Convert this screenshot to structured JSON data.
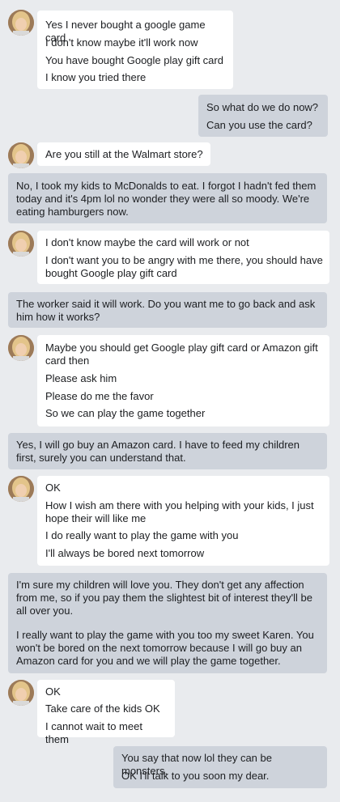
{
  "messages": [
    {
      "from": "them",
      "lines": [
        "Yes I never bought a google game card",
        "I don't know maybe it'll work now",
        "You have bought Google play gift card",
        "I know you tried there"
      ]
    },
    {
      "from": "me",
      "lines": [
        "So what do we do now?",
        "Can you use the card?"
      ]
    },
    {
      "from": "them",
      "lines": [
        "Are you still at the Walmart store?"
      ]
    },
    {
      "from": "me",
      "lines": [
        "No, I took my kids to McDonalds to eat. I forgot I hadn't fed them today and it's  4pm lol no wonder they were all so moody. We're eating hamburgers now."
      ]
    },
    {
      "from": "them",
      "lines": [
        "I don't know maybe the card will work or not",
        "I don't want you to be angry with me there, you should have bought Google play gift card"
      ]
    },
    {
      "from": "me",
      "lines": [
        "The worker said it will work. Do you want me to go back and ask him how it works?"
      ]
    },
    {
      "from": "them",
      "lines": [
        "Maybe you should get Google play gift card or Amazon gift card then",
        "Please ask him",
        "Please do me the favor",
        "So we can play the game together"
      ]
    },
    {
      "from": "me",
      "lines": [
        "Yes, I will go buy an Amazon card. I have to feed my children first, surely you can understand that."
      ]
    },
    {
      "from": "them",
      "lines": [
        "OK",
        "How I wish am there with you helping with your kids, I just hope their will like me",
        "I do really want to play the game with you",
        "I'll always be bored next tomorrow"
      ]
    },
    {
      "from": "me",
      "lines": [
        "I'm sure my children will love you. They don't get any affection from me, so if you pay them the slightest bit of interest they'll be all over you.",
        "I really want to play the game with you too my sweet Karen. You won't be bored on the next tomorrow because I will go buy an Amazon card for you and we will play the game together."
      ]
    },
    {
      "from": "them",
      "lines": [
        "OK",
        "Take care of the kids OK",
        "I cannot wait to meet them"
      ]
    },
    {
      "from": "me",
      "lines": [
        "You say that now lol they can be monsters.",
        "OK I'll talk to you soon my dear."
      ]
    }
  ]
}
